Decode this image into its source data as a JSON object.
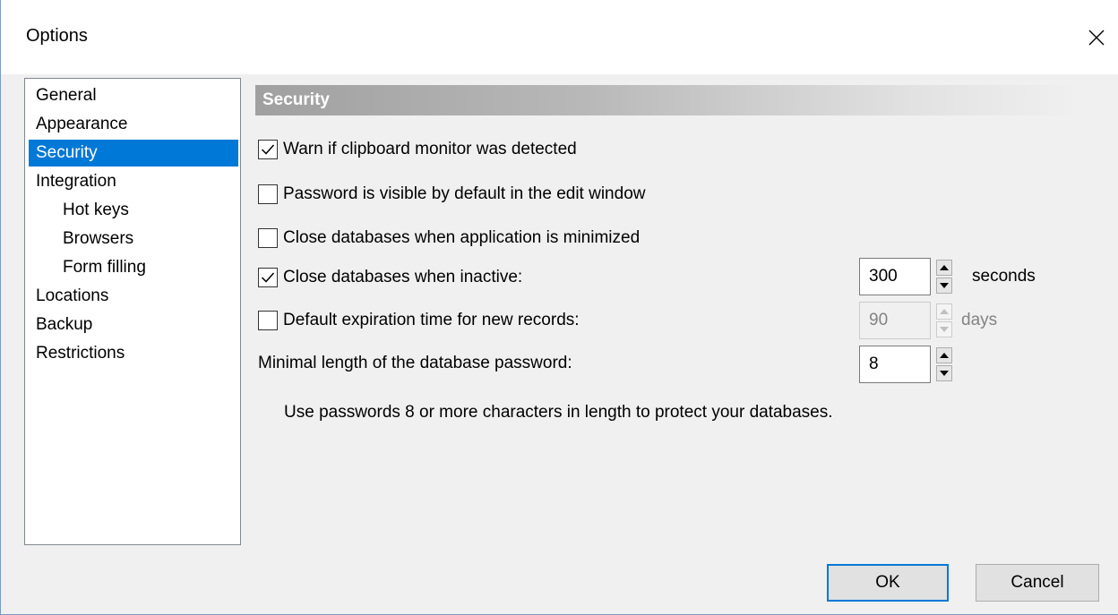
{
  "window": {
    "title": "Options"
  },
  "nav": {
    "items": [
      {
        "label": "General",
        "sub": false,
        "selected": false
      },
      {
        "label": "Appearance",
        "sub": false,
        "selected": false
      },
      {
        "label": "Security",
        "sub": false,
        "selected": true
      },
      {
        "label": "Integration",
        "sub": false,
        "selected": false
      },
      {
        "label": "Hot keys",
        "sub": true,
        "selected": false
      },
      {
        "label": "Browsers",
        "sub": true,
        "selected": false
      },
      {
        "label": "Form filling",
        "sub": true,
        "selected": false
      },
      {
        "label": "Locations",
        "sub": false,
        "selected": false
      },
      {
        "label": "Backup",
        "sub": false,
        "selected": false
      },
      {
        "label": "Restrictions",
        "sub": false,
        "selected": false
      }
    ]
  },
  "security": {
    "header": "Security",
    "options": [
      {
        "label": "Warn if clipboard monitor was detected",
        "checked": true
      },
      {
        "label": "Password is visible by default in the edit window",
        "checked": false
      },
      {
        "label": "Close databases when application is minimized",
        "checked": false
      },
      {
        "label": "Close databases when inactive:",
        "checked": true
      },
      {
        "label": "Default expiration time for new records:",
        "checked": false
      }
    ],
    "inactive_timeout": {
      "value": "300",
      "unit": "seconds"
    },
    "expiration": {
      "value": "90",
      "unit": "days",
      "enabled": false
    },
    "min_length_label": "Minimal length of the database password:",
    "min_length": {
      "value": "8"
    },
    "hint": "Use passwords 8 or more characters in length to protect your databases."
  },
  "buttons": {
    "ok": "OK",
    "cancel": "Cancel"
  },
  "colors": {
    "selection": "#0078d7",
    "window_bg": "#f0f0f0",
    "default_button_border": "#0078d7"
  }
}
